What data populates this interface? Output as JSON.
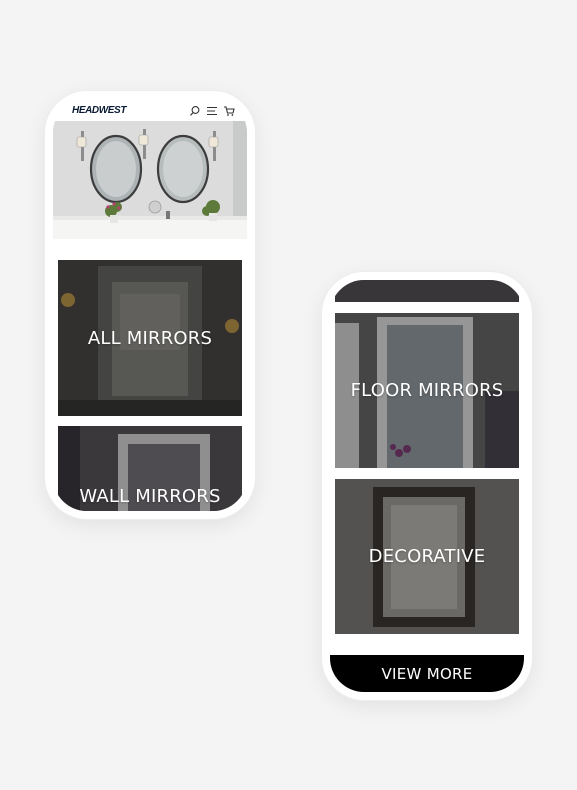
{
  "brand": {
    "logo_text": "HEADWEST"
  },
  "header": {
    "icons": [
      "search-icon",
      "menu-icon",
      "cart-icon"
    ]
  },
  "categories": [
    {
      "label": "ALL MIRRORS"
    },
    {
      "label": "WALL MIRRORS"
    },
    {
      "label": "FLOOR MIRRORS"
    },
    {
      "label": "DECORATIVE"
    }
  ],
  "cta": {
    "view_more_label": "VIEW MORE"
  },
  "colors": {
    "background": "#f4f4f4",
    "cta_background": "#000000",
    "tile_text": "#ffffff"
  }
}
